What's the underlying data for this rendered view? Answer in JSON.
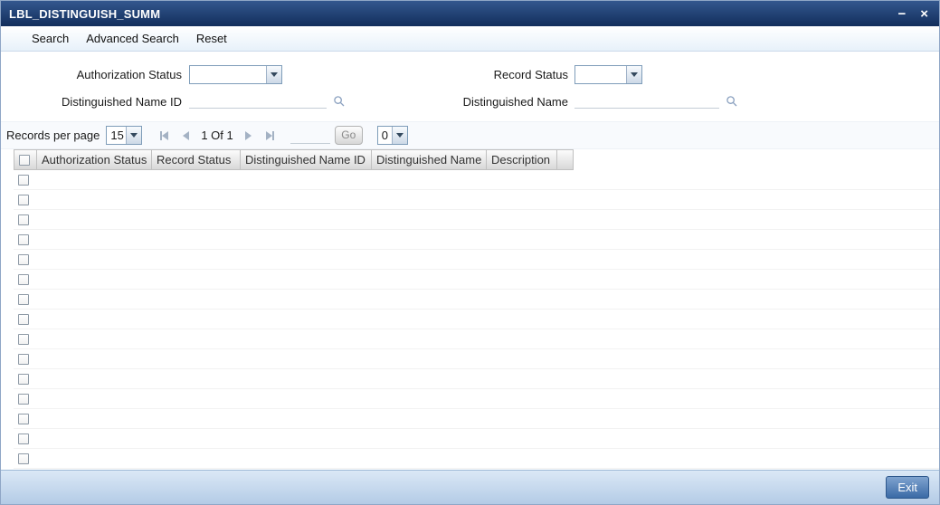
{
  "window": {
    "title": "LBL_DISTINGUISH_SUMM",
    "minimize_label": "−",
    "close_label": "×"
  },
  "menu": {
    "search": "Search",
    "advanced_search": "Advanced Search",
    "reset": "Reset"
  },
  "filters": {
    "authorization_status": {
      "label": "Authorization Status",
      "value": ""
    },
    "record_status": {
      "label": "Record Status",
      "value": ""
    },
    "distinguished_name_id": {
      "label": "Distinguished Name ID",
      "value": ""
    },
    "distinguished_name": {
      "label": "Distinguished Name",
      "value": ""
    }
  },
  "pagination": {
    "records_per_page_label": "Records per page",
    "records_per_page_value": "15",
    "page_indicator": "1 Of 1",
    "page_input_value": "",
    "go_button_label": "Go",
    "lock_columns_value": "0"
  },
  "grid": {
    "columns": [
      "Authorization Status",
      "Record Status",
      "Distinguished Name ID",
      "Distinguished Name",
      "Description"
    ],
    "empty_row_count": 15,
    "rows": []
  },
  "footer": {
    "exit_button_label": "Exit"
  },
  "colors": {
    "titlebar_top": "#33578e",
    "titlebar_bottom": "#122e5c",
    "accent_blue": "#3a6aa6"
  }
}
